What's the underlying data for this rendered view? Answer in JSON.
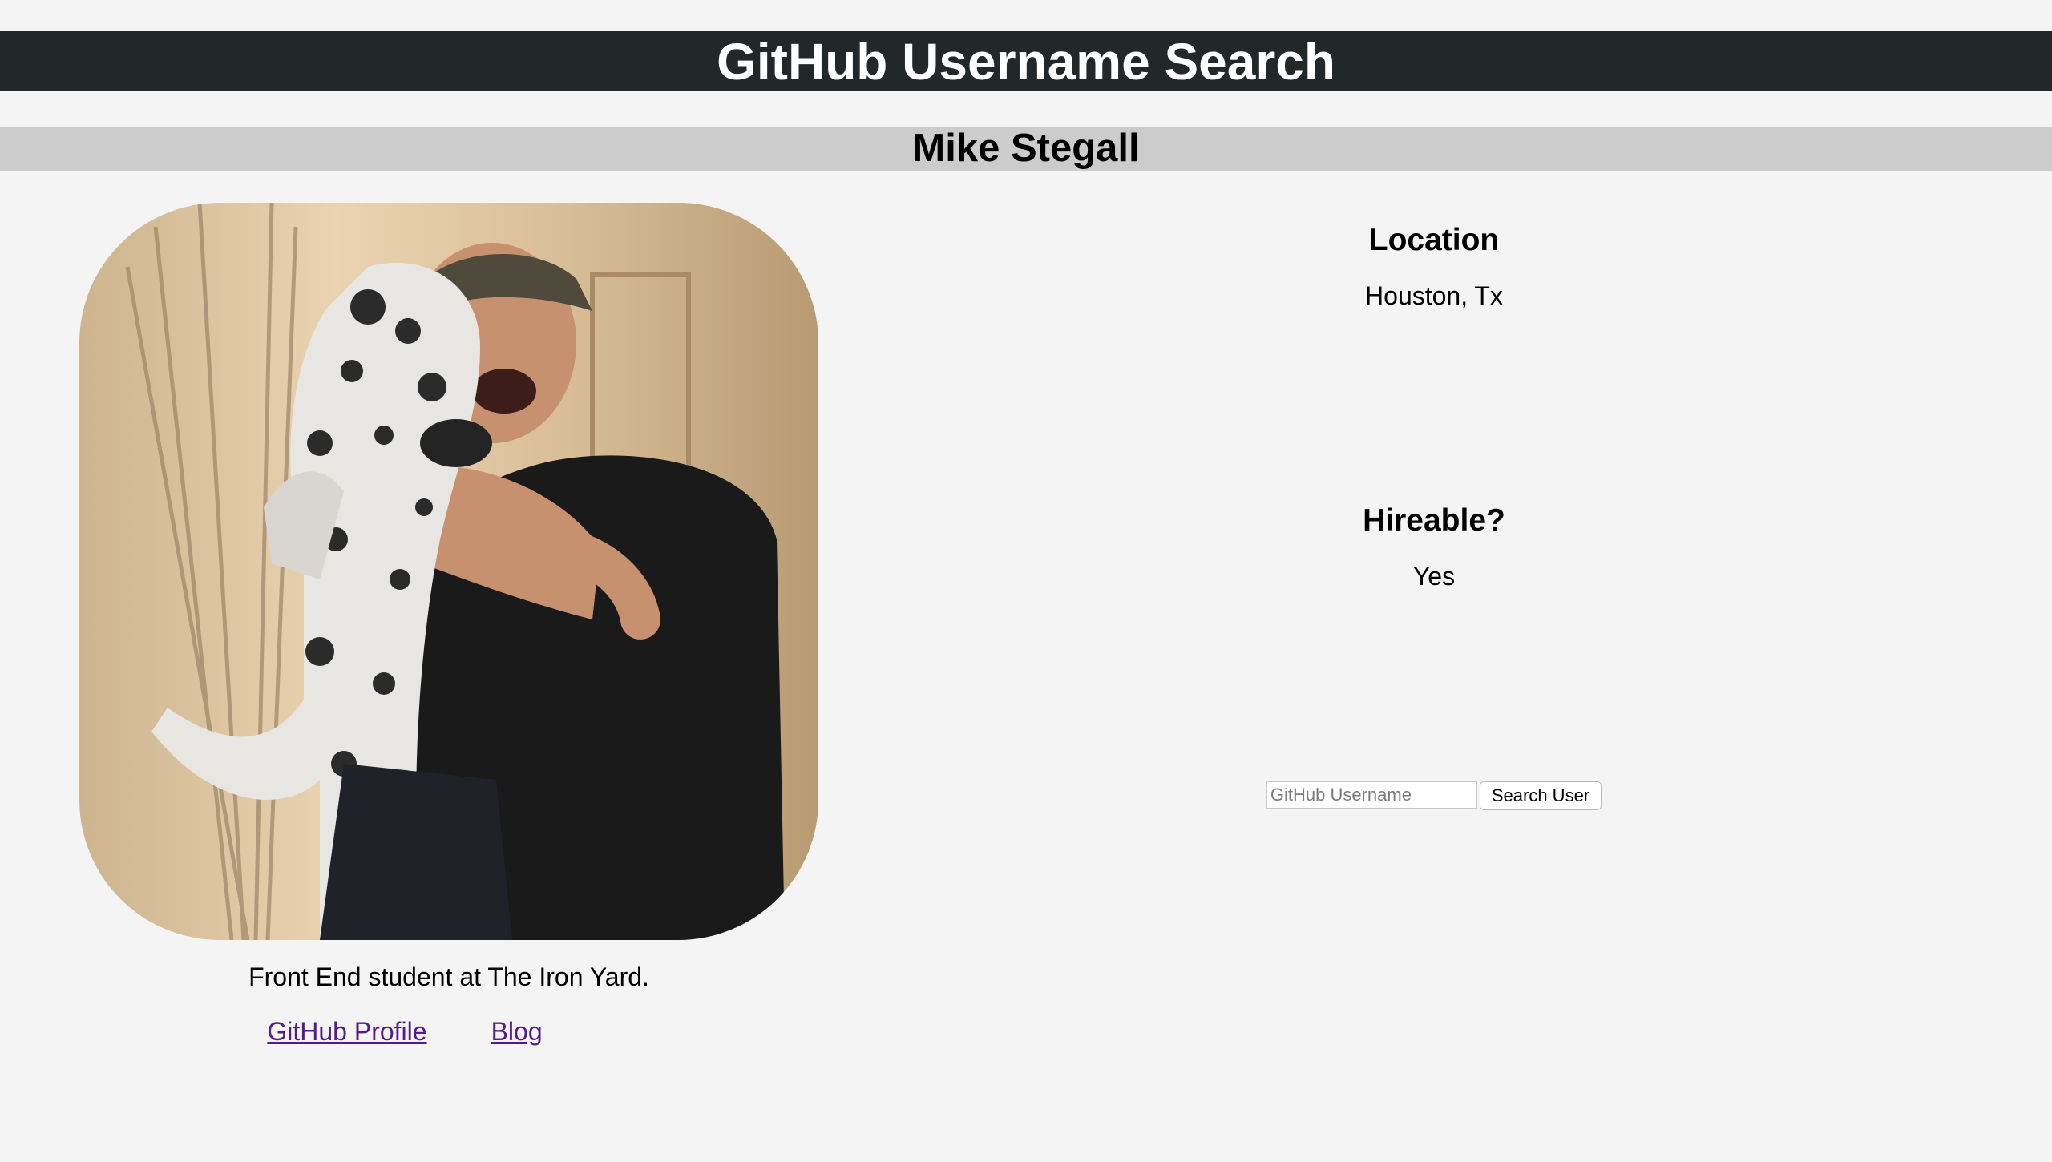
{
  "app": {
    "title": "GitHub Username Search"
  },
  "user": {
    "name": "Mike Stegall",
    "bio": "Front End student at The Iron Yard.",
    "links": {
      "profile_label": "GitHub Profile",
      "blog_label": "Blog"
    }
  },
  "info": {
    "location_heading": "Location",
    "location_value": "Houston, Tx",
    "hireable_heading": "Hireable?",
    "hireable_value": "Yes"
  },
  "search": {
    "placeholder": "GitHub Username",
    "value": "",
    "button_label": "Search User"
  },
  "colors": {
    "header_bg": "#22272a",
    "name_bar_bg": "#cccccc",
    "page_bg": "#f4f4f4",
    "link_visited": "#551a8b"
  }
}
